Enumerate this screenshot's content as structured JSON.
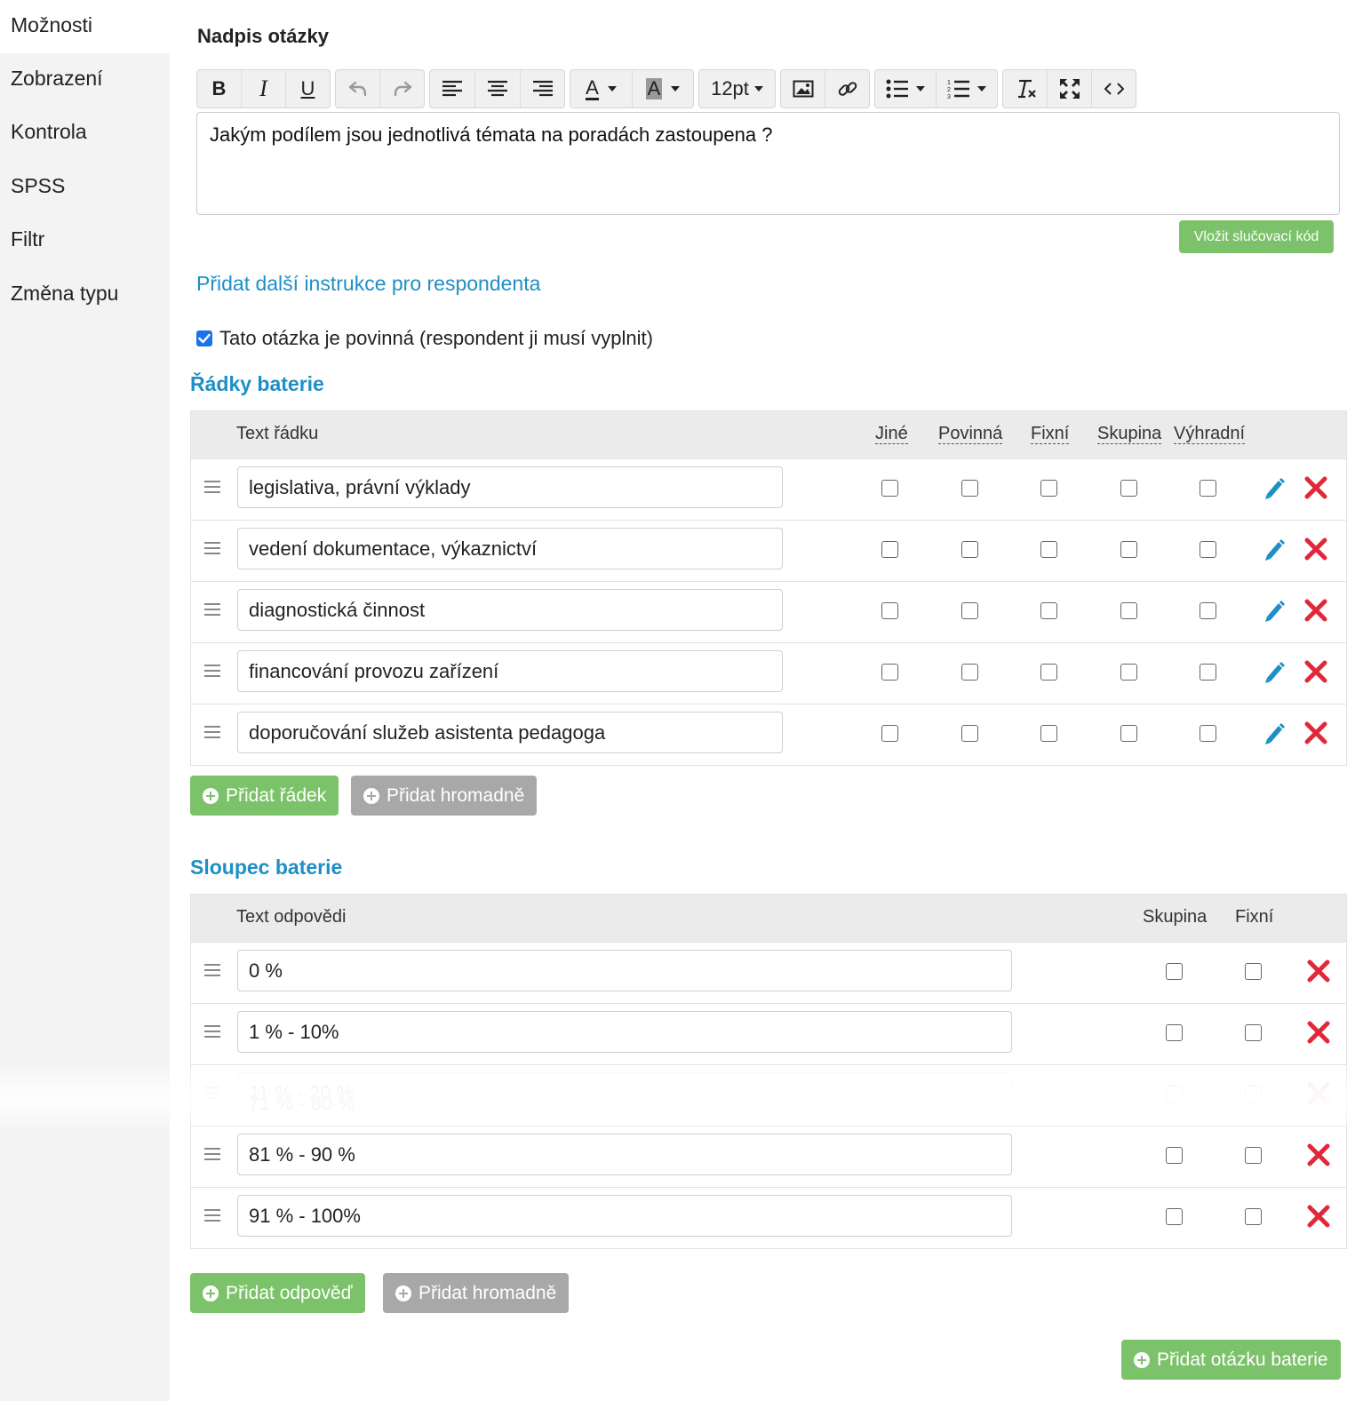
{
  "sidebar": {
    "items": [
      {
        "label": "Možnosti"
      },
      {
        "label": "Zobrazení"
      },
      {
        "label": "Kontrola"
      },
      {
        "label": "SPSS"
      },
      {
        "label": "Filtr"
      },
      {
        "label": "Změna typu"
      }
    ]
  },
  "question": {
    "heading": "Nadpis otázky",
    "text": "Jakým podílem jsou jednotlivá témata na poradách zastoupena ?",
    "merge_code_button": "Vložit slučovací kód",
    "instructions_link": "Přidat další instrukce pro respondenta",
    "required_label": "Tato otázka je povinná (respondent ji musí vyplnit)",
    "required_checked": true
  },
  "toolbar": {
    "font_size": "12pt",
    "font_color_letter": "A",
    "bg_color_letter": "A"
  },
  "rows_section": {
    "heading": "Řádky baterie",
    "columns": {
      "text": "Text řádku",
      "other": "Jiné",
      "required": "Povinná",
      "fixed": "Fixní",
      "group": "Skupina",
      "exclusive": "Výhradní"
    },
    "rows": [
      {
        "text": "legislativa, právní výklady"
      },
      {
        "text": "vedení dokumentace, výkaznictví"
      },
      {
        "text": "diagnostická činnost"
      },
      {
        "text": "financování provozu zařízení"
      },
      {
        "text": "doporučování služeb asistenta pedagoga"
      }
    ],
    "add_row_button": "Přidat řádek",
    "add_bulk_button": "Přidat hromadně"
  },
  "columns_section": {
    "heading": "Sloupec baterie",
    "columns": {
      "text": "Text odpovědi",
      "group": "Skupina",
      "fixed": "Fixní"
    },
    "answers": [
      {
        "text": "0 %"
      },
      {
        "text": "1 %  - 10%"
      },
      {
        "text": "11 % - 20 %",
        "overlay": "71 % - 80 %"
      },
      {
        "text": "81 % - 90 %"
      },
      {
        "text": "91 % - 100%"
      }
    ],
    "add_answer_button": "Přidat odpověď",
    "add_bulk_button": "Přidat hromadně"
  },
  "add_battery_button": "Přidat otázku baterie",
  "colors": {
    "accent_blue": "#1e8fc6",
    "green": "#7cc26a",
    "gray_button": "#a8a8a8",
    "delete_red": "#e0283a"
  }
}
